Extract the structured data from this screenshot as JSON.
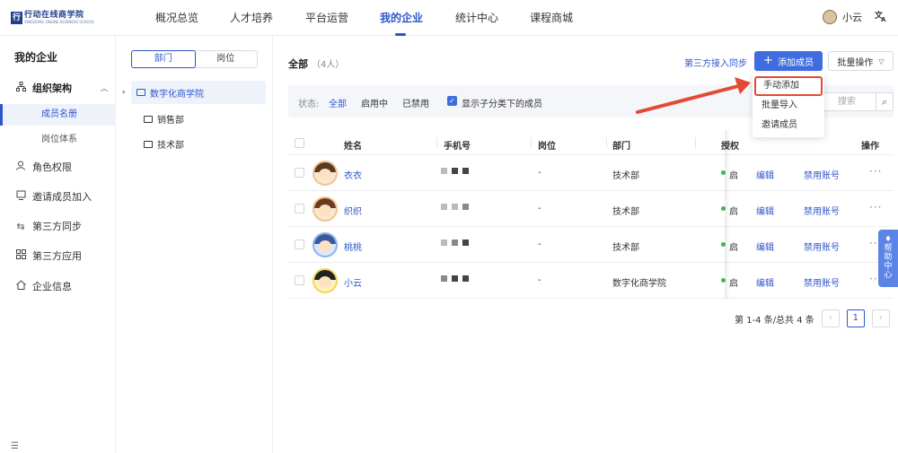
{
  "app": {
    "logo_text": "行动在线商学院",
    "logo_subtext": "XINGDONG ONLINE BUSINESS SCHOOL"
  },
  "nav": {
    "items": [
      {
        "label": "概况总览"
      },
      {
        "label": "人才培养"
      },
      {
        "label": "平台运营"
      },
      {
        "label": "我的企业"
      },
      {
        "label": "统计中心"
      },
      {
        "label": "课程商城"
      }
    ],
    "active_index": 3,
    "user_name": "小云",
    "lang_icon": "translate-icon"
  },
  "sidebar": {
    "title": "我的企业",
    "items": [
      {
        "label": "组织架构",
        "icon": "org-chart-icon",
        "expanded": true
      },
      {
        "label": "成员名册",
        "active": true
      },
      {
        "label": "岗位体系"
      },
      {
        "label": "角色权限",
        "icon": "user-role-icon"
      },
      {
        "label": "邀请成员加入",
        "icon": "invite-icon"
      },
      {
        "label": "第三方同步",
        "icon": "sync-icon"
      },
      {
        "label": "第三方应用",
        "icon": "apps-icon"
      },
      {
        "label": "企业信息",
        "icon": "home-icon"
      }
    ]
  },
  "tree": {
    "tabs": [
      {
        "label": "部门"
      },
      {
        "label": "岗位"
      }
    ],
    "active_tab": 0,
    "root": "数字化商学院",
    "children": [
      {
        "label": "销售部"
      },
      {
        "label": "技术部"
      }
    ]
  },
  "main": {
    "title": "全部",
    "count": "（4人）",
    "sync_link": "第三方接入同步",
    "add_button": "添加成员",
    "batch_button": "批量操作",
    "filter": {
      "label": "状态:",
      "options": [
        {
          "label": "全部"
        },
        {
          "label": "启用中"
        },
        {
          "label": "已禁用"
        }
      ],
      "active_index": 0,
      "checkbox_label": "显示子分类下的成员",
      "checkbox_checked": true,
      "search_placeholder": "搜索"
    },
    "table": {
      "headers": [
        "姓名",
        "手机号",
        "岗位",
        "部门",
        "授权",
        "操作"
      ],
      "rows": [
        {
          "name": "衣衣",
          "position": "-",
          "department": "技术部",
          "status": "启",
          "edit": "编辑",
          "disable": "禁用账号",
          "more": "···"
        },
        {
          "name": "织织",
          "position": "-",
          "department": "技术部",
          "status": "启",
          "edit": "编辑",
          "disable": "禁用账号",
          "more": "···"
        },
        {
          "name": "桃桃",
          "position": "-",
          "department": "技术部",
          "status": "启",
          "edit": "编辑",
          "disable": "禁用账号",
          "more": "···"
        },
        {
          "name": "小云",
          "position": "-",
          "department": "数字化商学院",
          "status": "启",
          "edit": "编辑",
          "disable": "禁用账号",
          "more": "···"
        }
      ]
    },
    "pagination": {
      "summary": "第 1-4 条/总共 4 条",
      "current_page": "1",
      "prev": "‹",
      "next": "›"
    }
  },
  "dropdown": {
    "items": [
      {
        "label": "手动添加",
        "highlighted": true
      },
      {
        "label": "批量导入"
      },
      {
        "label": "邀请成员"
      }
    ]
  },
  "help_tab": {
    "label": "帮助中心"
  },
  "colors": {
    "primary": "#3f6ddf",
    "link": "#2f55c9",
    "annotation": "#e34a33",
    "status_on": "#3cb45a"
  }
}
